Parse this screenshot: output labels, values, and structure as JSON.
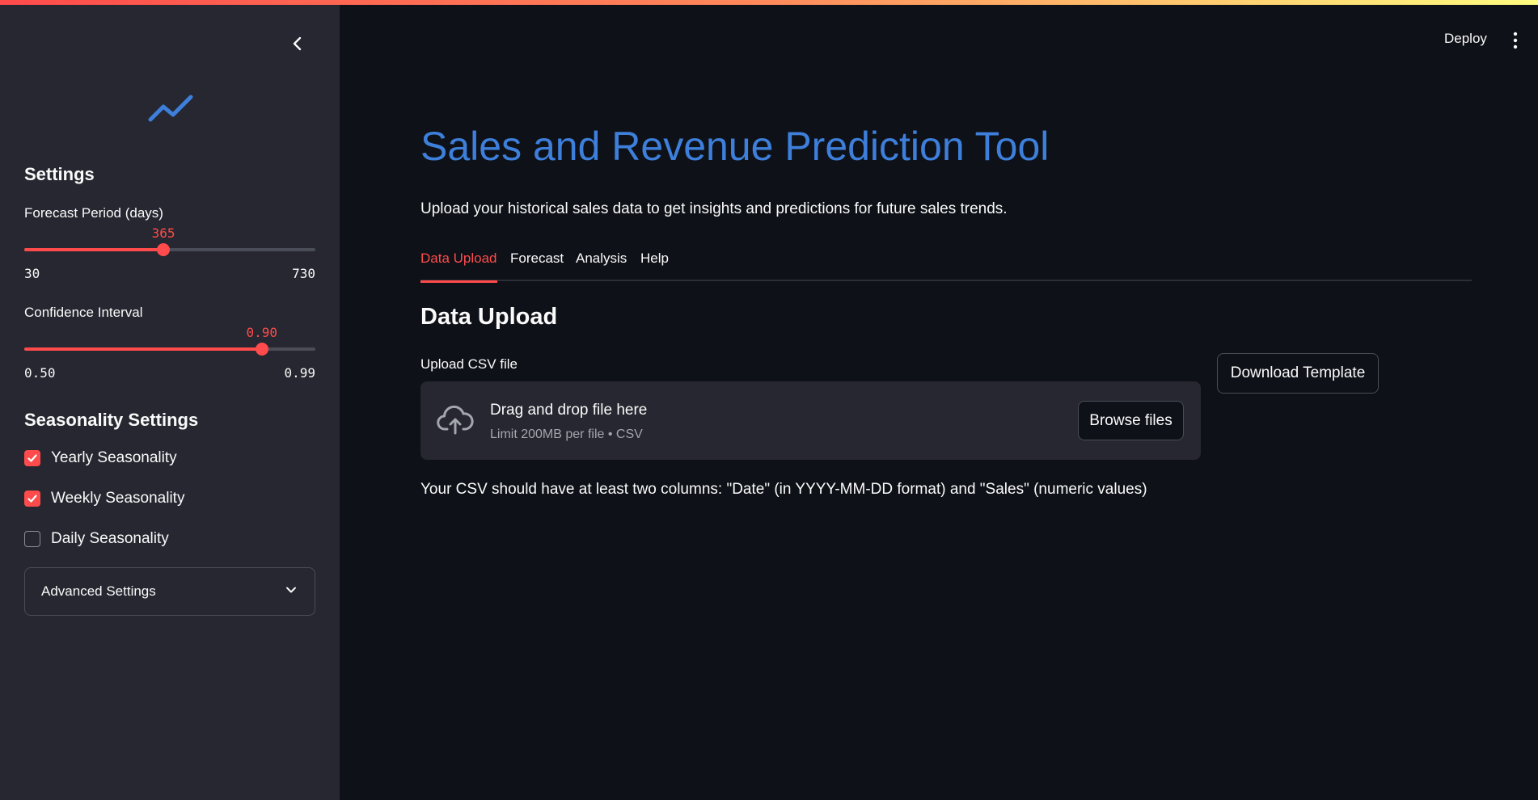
{
  "header": {
    "deploy_label": "Deploy"
  },
  "sidebar": {
    "settings_heading": "Settings",
    "forecast_slider": {
      "label": "Forecast Period (days)",
      "value": "365",
      "min": "30",
      "max": "730",
      "fraction": 0.478
    },
    "confidence_slider": {
      "label": "Confidence Interval",
      "value": "0.90",
      "min": "0.50",
      "max": "0.99",
      "fraction": 0.816
    },
    "seasonality_heading": "Seasonality Settings",
    "checkboxes": [
      {
        "label": "Yearly Seasonality",
        "checked": true
      },
      {
        "label": "Weekly Seasonality",
        "checked": true
      },
      {
        "label": "Daily Seasonality",
        "checked": false
      }
    ],
    "advanced_label": "Advanced Settings"
  },
  "main": {
    "title": "Sales and Revenue Prediction Tool",
    "subtitle": "Upload your historical sales data to get insights and predictions for future sales trends.",
    "tabs": [
      {
        "label": "Data Upload",
        "active": true
      },
      {
        "label": "Forecast",
        "active": false
      },
      {
        "label": "Analysis",
        "active": false
      },
      {
        "label": "Help",
        "active": false
      }
    ],
    "section_heading": "Data Upload",
    "upload": {
      "label": "Upload CSV file",
      "drop_text": "Drag and drop file here",
      "limit_text": "Limit 200MB per file • CSV",
      "browse_label": "Browse files"
    },
    "download_template_label": "Download Template",
    "note": "Your CSV should have at least two columns: \"Date\" (in YYYY-MM-DD format) and \"Sales\" (numeric values)"
  },
  "colors": {
    "accent": "#ff4b4b",
    "title": "#3d7fdb",
    "background": "#0e1117",
    "sidebar": "#262730"
  }
}
